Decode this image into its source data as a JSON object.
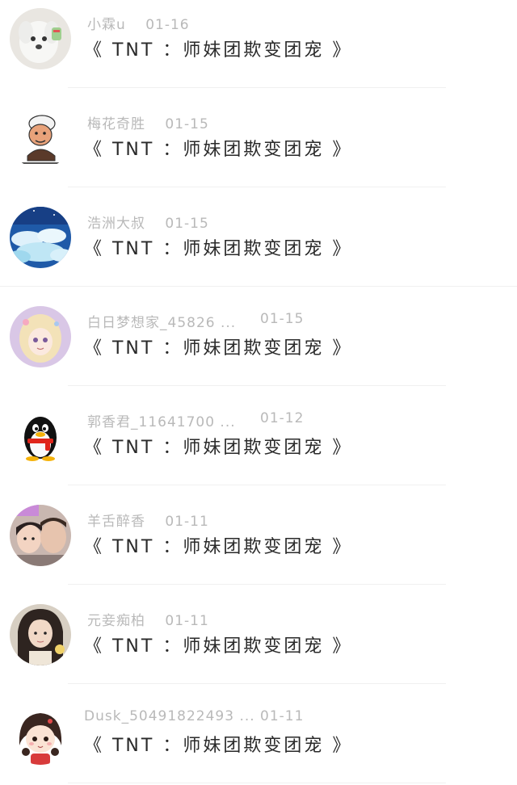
{
  "comments": [
    {
      "username": "小霖u",
      "date": "01-16",
      "text": "《 TNT ：师妹团欺变团宠 》",
      "avatar_icon": "white-puppy-avatar"
    },
    {
      "username": "梅花奇胜",
      "date": "01-15",
      "text": "《 TNT ：师妹团欺变团宠 》",
      "avatar_icon": "cartoon-man-meme-avatar"
    },
    {
      "username": "浩洲大叔",
      "date": "01-15",
      "text": "《 TNT ：师妹团欺变团宠 》",
      "avatar_icon": "sky-clouds-avatar"
    },
    {
      "username": "白日梦想家_45826 ...",
      "date": "01-15",
      "text": "《 TNT ：师妹团欺变团宠 》",
      "avatar_icon": "anime-girl-avatar"
    },
    {
      "username": "郭香君_11641700 ...",
      "date": "01-12",
      "text": "《 TNT ：师妹团欺变团宠 》",
      "avatar_icon": "qq-penguin-avatar"
    },
    {
      "username": "羊舌醉香",
      "date": "01-11",
      "text": "《 TNT ：师妹团欺变团宠 》",
      "avatar_icon": "couple-photo-avatar"
    },
    {
      "username": "元妾痴柏",
      "date": "01-11",
      "text": "《 TNT ：师妹团欺变团宠 》",
      "avatar_icon": "girl-portrait-avatar"
    },
    {
      "username": "Dusk_50491822493 ...",
      "date": "01-11",
      "text": "《 TNT ：师妹团欺变团宠 》",
      "avatar_icon": "cartoon-girl-avatar"
    }
  ]
}
